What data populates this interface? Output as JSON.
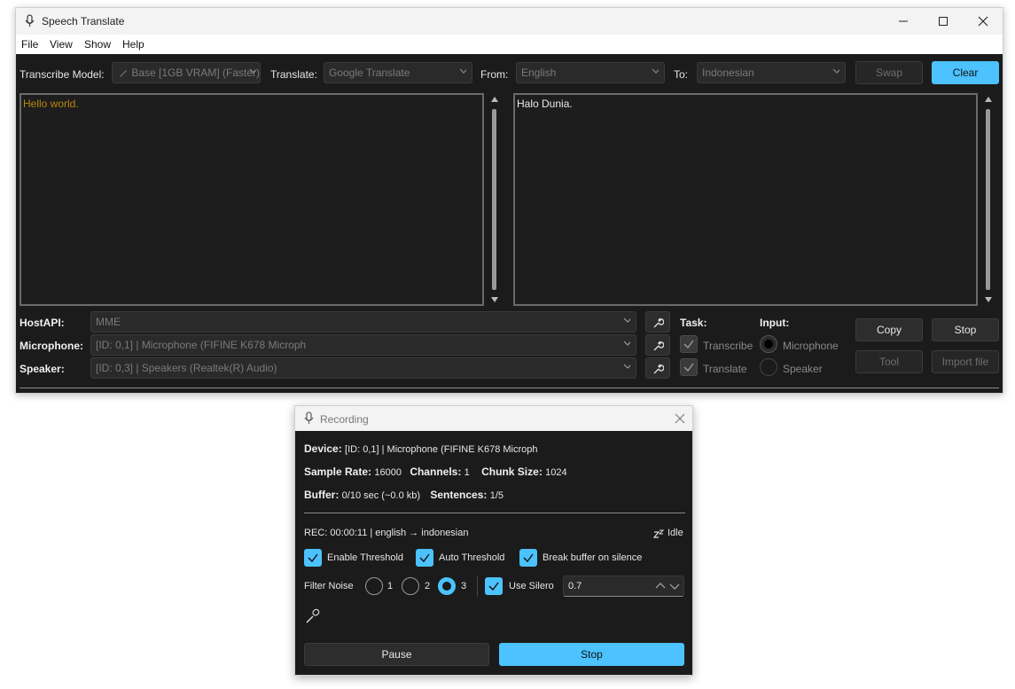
{
  "main": {
    "title": "Speech Translate",
    "menu": [
      "File",
      "View",
      "Show",
      "Help"
    ],
    "toolbar": {
      "model_label": "Transcribe Model:",
      "model_value": "Base [1GB VRAM] (Faster)",
      "translate_label": "Translate:",
      "translate_value": "Google Translate",
      "from_label": "From:",
      "from_value": "English",
      "to_label": "To:",
      "to_value": "Indonesian",
      "swap": "Swap",
      "clear": "Clear"
    },
    "source_text": "Hello world.",
    "target_text": "Halo Dunia.",
    "bottom": {
      "hostapi_label": "HostAPI:",
      "hostapi_value": "MME",
      "mic_label": "Microphone:",
      "mic_value": "[ID: 0,1] | Microphone (FIFINE K678 Microph",
      "speaker_label": "Speaker:",
      "speaker_value": "[ID: 0,3] | Speakers (Realtek(R) Audio)",
      "task_label": "Task:",
      "task_transcribe": "Transcribe",
      "task_translate": "Translate",
      "input_label": "Input:",
      "input_mic": "Microphone",
      "input_speaker": "Speaker",
      "copy": "Copy",
      "stop": "Stop",
      "tool": "Tool",
      "import": "Import file"
    }
  },
  "recording": {
    "title": "Recording",
    "device_label": "Device:",
    "device_value": "[ID: 0,1] | Microphone (FIFINE K678 Microph",
    "sample_rate_label": "Sample Rate:",
    "sample_rate_value": "16000",
    "channels_label": "Channels:",
    "channels_value": "1",
    "chunk_label": "Chunk Size:",
    "chunk_value": "1024",
    "buffer_label": "Buffer:",
    "buffer_value": "0/10 sec (~0.0 kb)",
    "sentences_label": "Sentences:",
    "sentences_value": "1/5",
    "rec_status": "REC: 00:00:11 | english → indonesian",
    "idle": "Idle",
    "enable_threshold": "Enable Threshold",
    "auto_threshold": "Auto Threshold",
    "break_buffer": "Break buffer on silence",
    "filter_noise": "Filter Noise",
    "filter_options": [
      "1",
      "2",
      "3"
    ],
    "use_silero": "Use Silero",
    "silero_value": "0.7",
    "pause": "Pause",
    "stop": "Stop"
  },
  "colors": {
    "accent": "#4cc2ff",
    "source_text": "#b8860b",
    "bg": "#1b1b1b"
  }
}
